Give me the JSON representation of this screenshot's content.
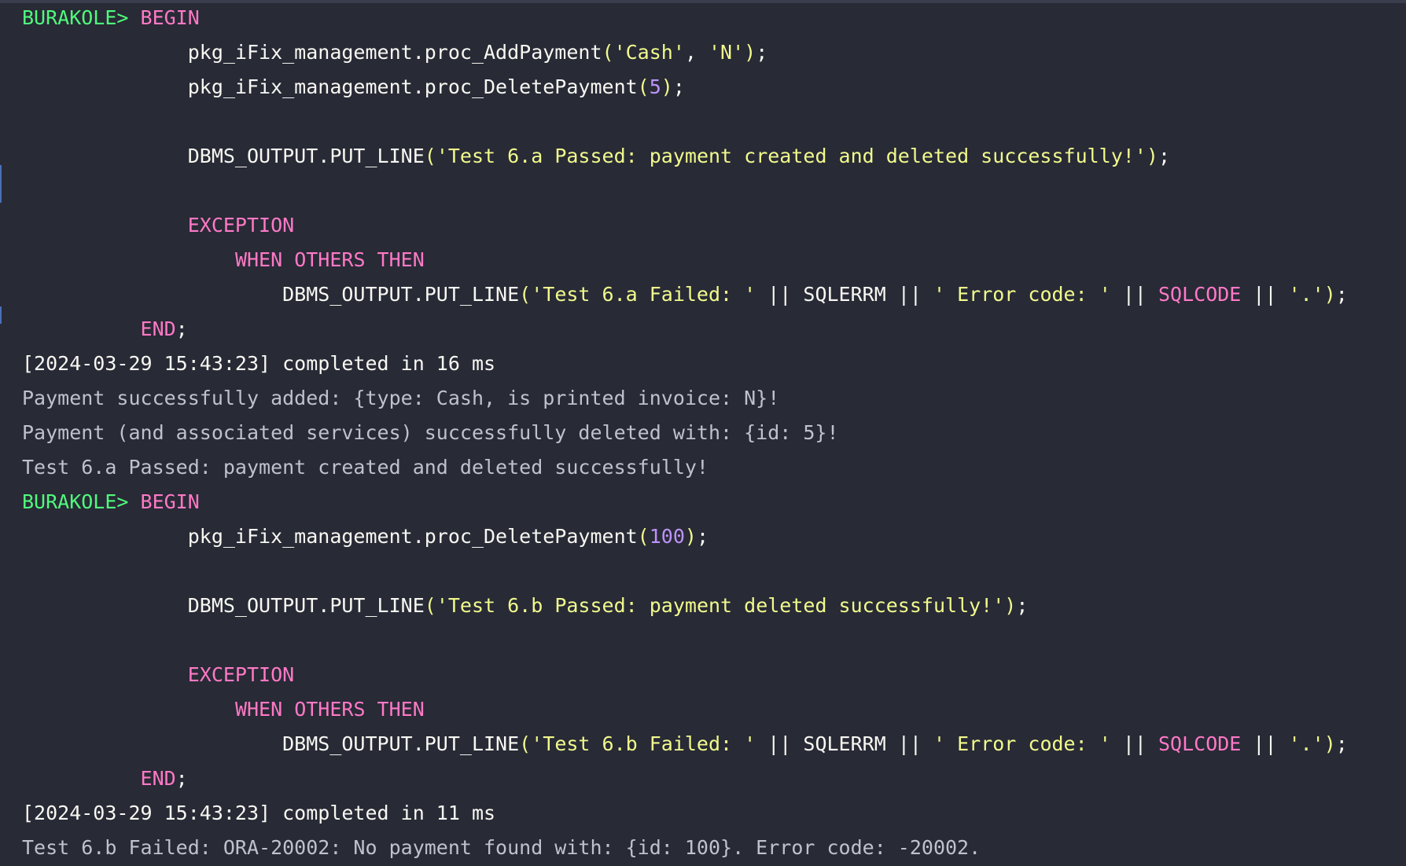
{
  "app": {
    "accent_prompt": "#50fa7b",
    "accent_keyword": "#ff79c6",
    "accent_string": "#f1fa8c",
    "accent_number": "#bd93f9",
    "background": "#282a36"
  },
  "console": {
    "lines": [
      {
        "kind": "code",
        "tokens": [
          {
            "t": "BURAKOLE> ",
            "c": "prompt"
          },
          {
            "t": "BEGIN",
            "c": "kw"
          }
        ]
      },
      {
        "kind": "code",
        "tokens": [
          {
            "t": "              pkg_iFix_management.proc_AddPayment",
            "c": "plain"
          },
          {
            "t": "(",
            "c": "paren"
          },
          {
            "t": "'Cash'",
            "c": "str"
          },
          {
            "t": ", ",
            "c": "plain"
          },
          {
            "t": "'N'",
            "c": "str"
          },
          {
            "t": ")",
            "c": "paren"
          },
          {
            "t": ";",
            "c": "plain"
          }
        ]
      },
      {
        "kind": "code",
        "tokens": [
          {
            "t": "              pkg_iFix_management.proc_DeletePayment",
            "c": "plain"
          },
          {
            "t": "(",
            "c": "paren"
          },
          {
            "t": "5",
            "c": "num"
          },
          {
            "t": ")",
            "c": "paren"
          },
          {
            "t": ";",
            "c": "plain"
          }
        ]
      },
      {
        "kind": "blank",
        "tokens": []
      },
      {
        "kind": "code",
        "tokens": [
          {
            "t": "              DBMS_OUTPUT.PUT_LINE",
            "c": "plain"
          },
          {
            "t": "(",
            "c": "paren"
          },
          {
            "t": "'Test 6.a Passed: payment created and deleted successfully!'",
            "c": "str"
          },
          {
            "t": ")",
            "c": "paren"
          },
          {
            "t": ";",
            "c": "plain"
          }
        ]
      },
      {
        "kind": "blank",
        "tokens": []
      },
      {
        "kind": "code",
        "tokens": [
          {
            "t": "              ",
            "c": "plain"
          },
          {
            "t": "EXCEPTION",
            "c": "kw"
          }
        ]
      },
      {
        "kind": "code",
        "tokens": [
          {
            "t": "                  ",
            "c": "plain"
          },
          {
            "t": "WHEN OTHERS THEN",
            "c": "kw"
          }
        ]
      },
      {
        "kind": "code",
        "tokens": [
          {
            "t": "                      DBMS_OUTPUT.PUT_LINE",
            "c": "plain"
          },
          {
            "t": "(",
            "c": "paren"
          },
          {
            "t": "'Test 6.a Failed: '",
            "c": "str"
          },
          {
            "t": " || SQLERRM || ",
            "c": "plain"
          },
          {
            "t": "' Error code: '",
            "c": "str"
          },
          {
            "t": " || ",
            "c": "plain"
          },
          {
            "t": "SQLCODE",
            "c": "kw"
          },
          {
            "t": " || ",
            "c": "plain"
          },
          {
            "t": "'.'",
            "c": "str"
          },
          {
            "t": ")",
            "c": "paren"
          },
          {
            "t": ";",
            "c": "plain"
          }
        ]
      },
      {
        "kind": "code",
        "tokens": [
          {
            "t": "          ",
            "c": "plain"
          },
          {
            "t": "END",
            "c": "kw"
          },
          {
            "t": ";",
            "c": "plain"
          }
        ]
      },
      {
        "kind": "status",
        "tokens": [
          {
            "t": "[2024-03-29 15:43:23] completed in 16 ms",
            "c": "ts"
          }
        ]
      },
      {
        "kind": "output",
        "tokens": [
          {
            "t": "Payment successfully added: {type: Cash, is printed invoice: N}!",
            "c": "out"
          }
        ]
      },
      {
        "kind": "output",
        "tokens": [
          {
            "t": "Payment (and associated services) successfully deleted with: {id: 5}!",
            "c": "out"
          }
        ]
      },
      {
        "kind": "output",
        "tokens": [
          {
            "t": "Test 6.a Passed: payment created and deleted successfully!",
            "c": "out"
          }
        ]
      },
      {
        "kind": "code",
        "tokens": [
          {
            "t": "BURAKOLE> ",
            "c": "prompt"
          },
          {
            "t": "BEGIN",
            "c": "kw"
          }
        ]
      },
      {
        "kind": "code",
        "tokens": [
          {
            "t": "              pkg_iFix_management.proc_DeletePayment",
            "c": "plain"
          },
          {
            "t": "(",
            "c": "paren"
          },
          {
            "t": "100",
            "c": "num"
          },
          {
            "t": ")",
            "c": "paren"
          },
          {
            "t": ";",
            "c": "plain"
          }
        ]
      },
      {
        "kind": "blank",
        "tokens": []
      },
      {
        "kind": "code",
        "tokens": [
          {
            "t": "              DBMS_OUTPUT.PUT_LINE",
            "c": "plain"
          },
          {
            "t": "(",
            "c": "paren"
          },
          {
            "t": "'Test 6.b Passed: payment deleted successfully!'",
            "c": "str"
          },
          {
            "t": ")",
            "c": "paren"
          },
          {
            "t": ";",
            "c": "plain"
          }
        ]
      },
      {
        "kind": "blank",
        "tokens": []
      },
      {
        "kind": "code",
        "tokens": [
          {
            "t": "              ",
            "c": "plain"
          },
          {
            "t": "EXCEPTION",
            "c": "kw"
          }
        ]
      },
      {
        "kind": "code",
        "tokens": [
          {
            "t": "                  ",
            "c": "plain"
          },
          {
            "t": "WHEN OTHERS THEN",
            "c": "kw"
          }
        ]
      },
      {
        "kind": "code",
        "tokens": [
          {
            "t": "                      DBMS_OUTPUT.PUT_LINE",
            "c": "plain"
          },
          {
            "t": "(",
            "c": "paren"
          },
          {
            "t": "'Test 6.b Failed: '",
            "c": "str"
          },
          {
            "t": " || SQLERRM || ",
            "c": "plain"
          },
          {
            "t": "' Error code: '",
            "c": "str"
          },
          {
            "t": " || ",
            "c": "plain"
          },
          {
            "t": "SQLCODE",
            "c": "kw"
          },
          {
            "t": " || ",
            "c": "plain"
          },
          {
            "t": "'.'",
            "c": "str"
          },
          {
            "t": ")",
            "c": "paren"
          },
          {
            "t": ";",
            "c": "plain"
          }
        ]
      },
      {
        "kind": "code",
        "tokens": [
          {
            "t": "          ",
            "c": "plain"
          },
          {
            "t": "END",
            "c": "kw"
          },
          {
            "t": ";",
            "c": "plain"
          }
        ]
      },
      {
        "kind": "status",
        "tokens": [
          {
            "t": "[2024-03-29 15:43:23] completed in 11 ms",
            "c": "ts"
          }
        ]
      },
      {
        "kind": "output",
        "tokens": [
          {
            "t": "Test 6.b Failed: ORA-20002: No payment found with: {id: 100}. Error code: -20002.",
            "c": "out"
          }
        ]
      }
    ]
  }
}
